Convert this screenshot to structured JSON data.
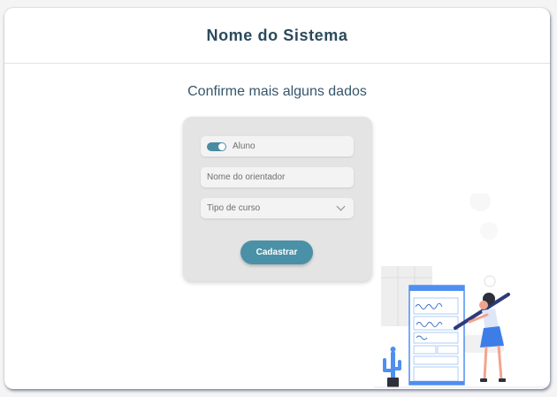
{
  "header": {
    "title": "Nome do Sistema"
  },
  "form": {
    "heading": "Confirme mais alguns dados",
    "toggle": {
      "label": "Aluno",
      "on": true
    },
    "advisor": {
      "placeholder": "Nome do orientador"
    },
    "course": {
      "placeholder": "Tipo de curso"
    },
    "submit_label": "Cadastrar"
  },
  "colors": {
    "accent": "#4a91a7",
    "title": "#2b4a5c",
    "card_bg": "#e4e4e4"
  },
  "icons": {
    "toggle": "toggle-switch-icon",
    "dropdown": "chevron-down-icon",
    "illustration": "woman-drawing-form-illustration"
  }
}
